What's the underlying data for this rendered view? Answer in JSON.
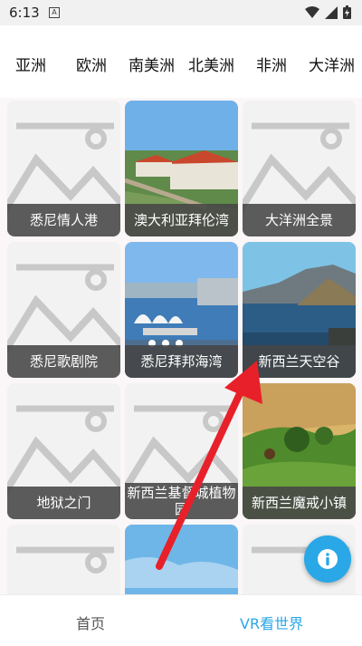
{
  "status": {
    "time": "6:13",
    "notification": "A"
  },
  "tabs": [
    "亚洲",
    "欧洲",
    "南美洲",
    "北美洲",
    "非洲",
    "大洋洲"
  ],
  "tiles": [
    "悉尼情人港",
    "澳大利亚拜伦湾",
    "大洋洲全景",
    "悉尼歌剧院",
    "悉尼拜邦海湾",
    "新西兰天空谷",
    "地狱之门",
    "新西兰基督城植物园",
    "新西兰魔戒小镇"
  ],
  "nav": {
    "home": "首页",
    "vr": "VR看世界"
  },
  "colors": {
    "accent": "#2aa7e6",
    "arrow": "#e8202a"
  },
  "icons": {
    "fab": "info-icon"
  }
}
